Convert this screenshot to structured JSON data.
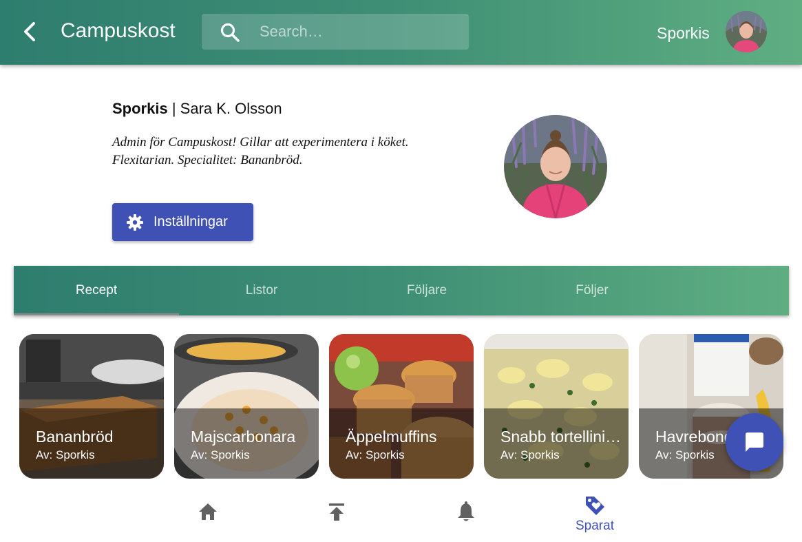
{
  "header": {
    "title": "Campuskost",
    "search_placeholder": "Search…",
    "user_name": "Sporkis"
  },
  "profile": {
    "username": "Sporkis",
    "separator": " | ",
    "full_name": "Sara K. Olsson",
    "bio": "Admin för Campuskost! Gillar att experimentera i köket. Flexitarian. Specialitet: Bananbröd.",
    "settings_label": "Inställningar"
  },
  "tabs": [
    {
      "label": "Recept",
      "active": true
    },
    {
      "label": "Listor",
      "active": false
    },
    {
      "label": "Följare",
      "active": false
    },
    {
      "label": "Följer",
      "active": false
    }
  ],
  "recipes": [
    {
      "title": "Bananbröd",
      "author": "Av: Sporkis",
      "icon": "banana-bread-photo"
    },
    {
      "title": "Majscarbonara",
      "author": "Av: Sporkis",
      "icon": "pasta-photo"
    },
    {
      "title": "Äppelmuffins",
      "author": "Av: Sporkis",
      "icon": "muffins-photo"
    },
    {
      "title": "Snabb tortellinigratäng",
      "author": "Av: Sporkis",
      "icon": "gratin-photo"
    },
    {
      "title": "Havrebonde",
      "author": "Av: Sporkis",
      "icon": "smoothie-photo"
    }
  ],
  "bottom_nav": [
    {
      "icon": "home-icon",
      "label": ""
    },
    {
      "icon": "upload-icon",
      "label": ""
    },
    {
      "icon": "bell-icon",
      "label": ""
    },
    {
      "icon": "tag-heart-icon",
      "label": "Sparat",
      "active": true
    }
  ],
  "colors": {
    "header_gradient_start": "#2e7d6e",
    "header_gradient_end": "#5fae82",
    "primary": "#3f51b5",
    "nav_inactive": "#616161"
  }
}
